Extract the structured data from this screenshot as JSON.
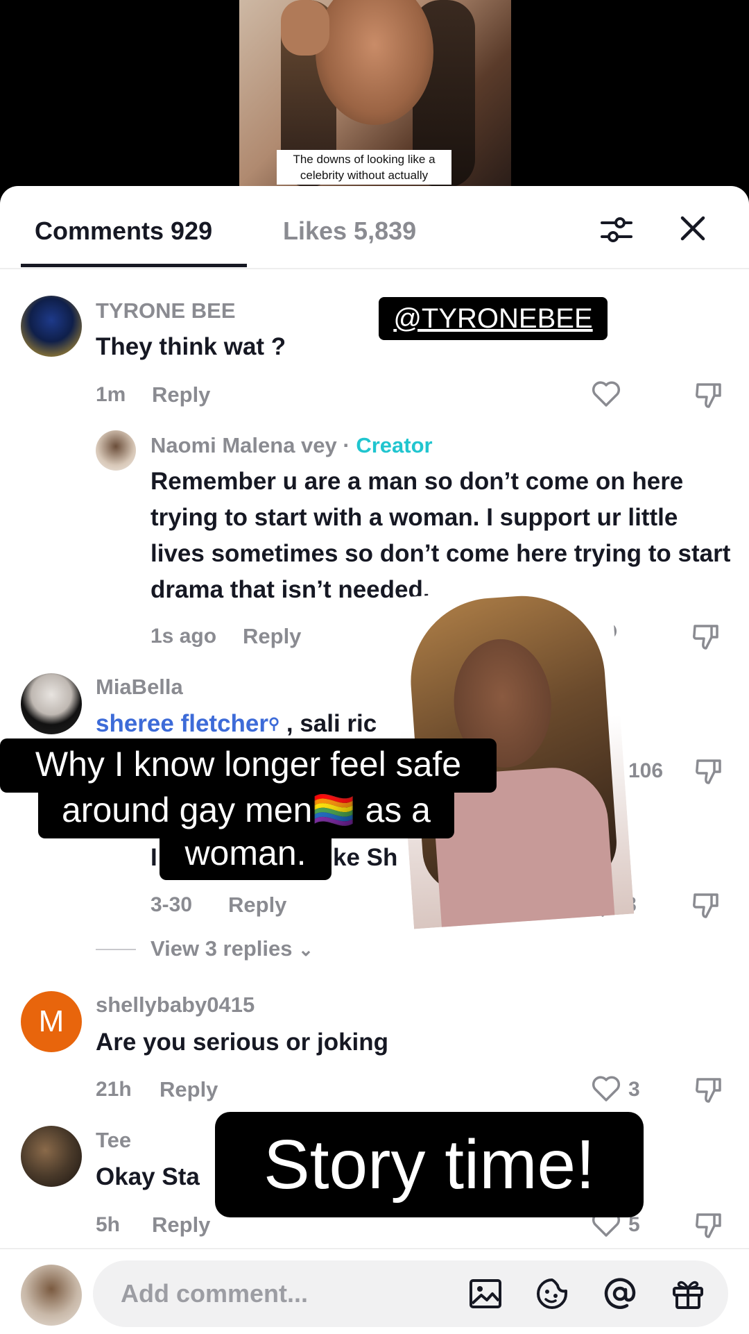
{
  "video": {
    "caption": "The downs of looking like a celebrity without actually"
  },
  "tabs": {
    "comments": "Comments 929",
    "likes": "Likes 5,839"
  },
  "overlays": {
    "handle": "@TYRONEBEE",
    "headline": [
      "Why I know longer feel safe",
      "around gay men🏳️‍🌈 as a",
      "woman."
    ],
    "story": "Story time!"
  },
  "comments": [
    {
      "name": "TYRONE BEE",
      "text": "They think wat ?",
      "time": "1m",
      "reply": "Reply"
    },
    {
      "name": "Naomi Malena vey · ",
      "badge": "Creator",
      "text": "Remember u are a man so don’t come on here trying to start with a woman. I support ur little lives sometimes so don’t come here trying to start drama that isn’t needed.",
      "time": "1s ago",
      "reply": "Reply"
    },
    {
      "name": "MiaBella",
      "mention": "sheree fletcher",
      "text_after": " , sali ric",
      "likes": "106"
    },
    {
      "partial_text_a": "I",
      "partial_text_b": "ke Sh",
      "time": "3-30",
      "reply": "Reply",
      "likes": "8",
      "view_replies": "View 3 replies"
    },
    {
      "name": "shellybaby0415",
      "avatar_letter": "M",
      "text": "Are you serious or joking",
      "time": "21h",
      "reply": "Reply",
      "likes": "3"
    },
    {
      "name": "Tee",
      "text": "Okay Sta",
      "time": "5h",
      "reply": "Reply",
      "likes": "5"
    }
  ],
  "composer": {
    "placeholder": "Add comment..."
  },
  "colors": {
    "creator": "#20c5cf",
    "mention": "#3d6bd8",
    "avatar_orange": "#e8650c"
  }
}
